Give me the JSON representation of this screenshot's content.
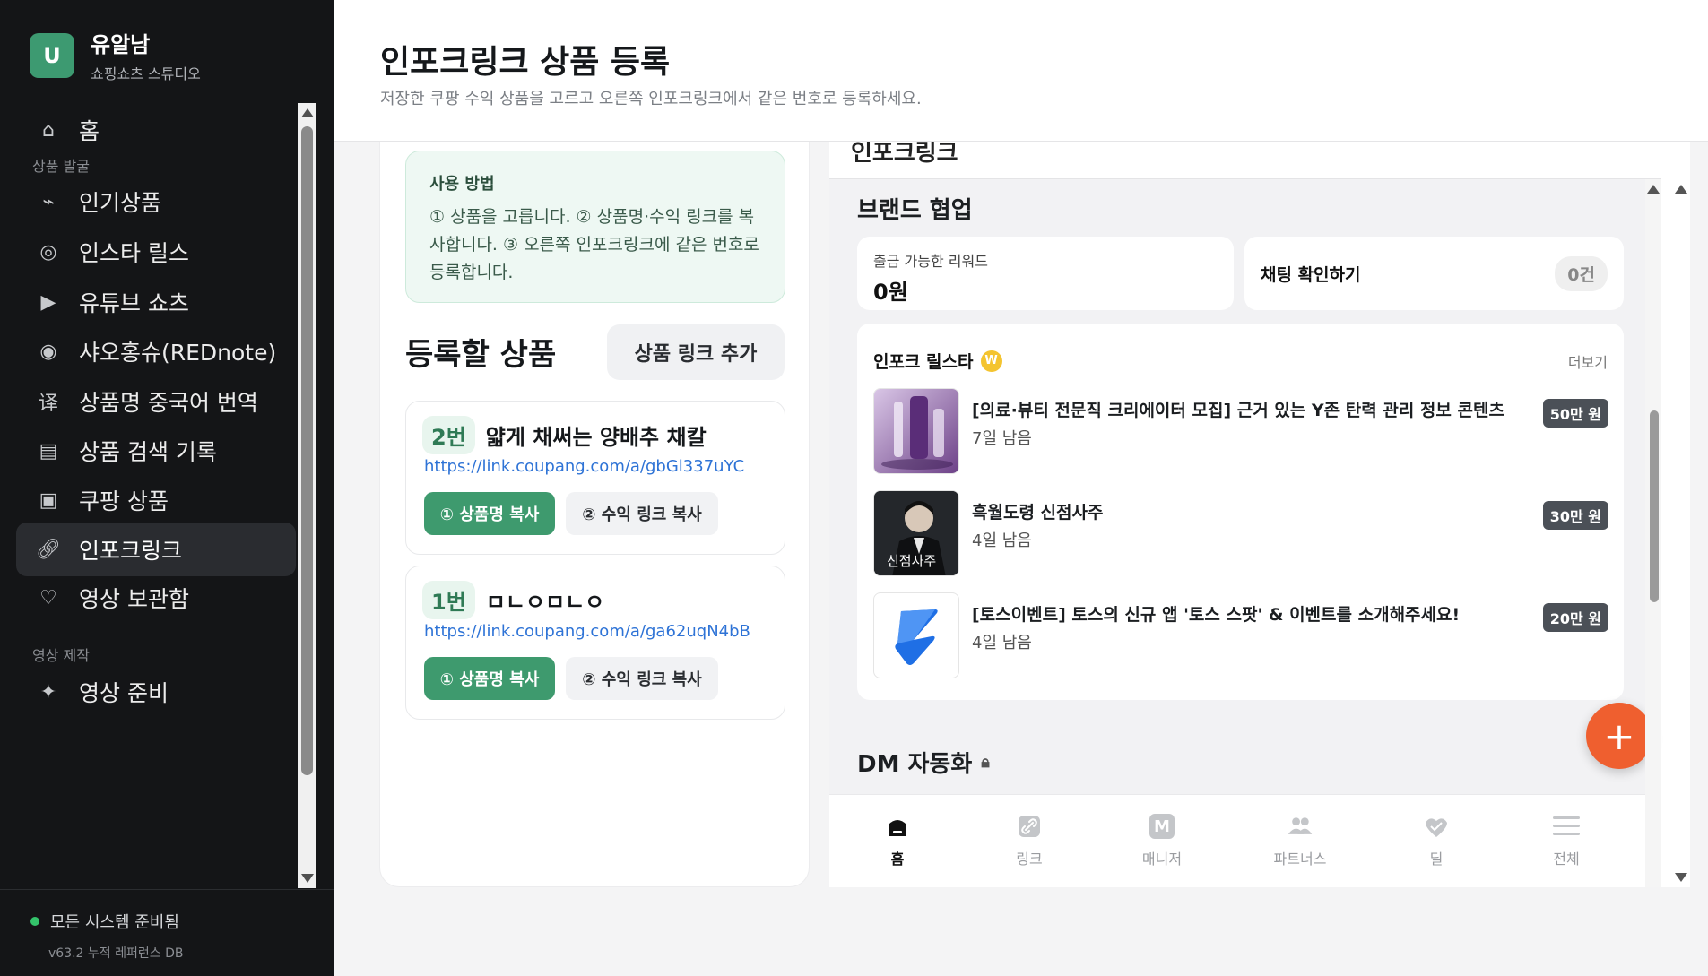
{
  "brand": {
    "initial": "U",
    "name": "유알남",
    "subtitle": "쇼핑쇼츠 스튜디오"
  },
  "sidebar": {
    "items": [
      {
        "label": "홈",
        "icon": "home-icon"
      },
      {
        "label": "인기상품",
        "icon": "trend-icon"
      },
      {
        "label": "인스타 릴스",
        "icon": "instagram-icon"
      },
      {
        "label": "유튜브 쇼츠",
        "icon": "play-icon"
      },
      {
        "label": "샤오홍슈(REDnote)",
        "icon": "record-icon"
      },
      {
        "label": "상품명 중국어 번역",
        "icon": "translate-icon"
      },
      {
        "label": "상품 검색 기록",
        "icon": "list-icon"
      },
      {
        "label": "쿠팡 상품",
        "icon": "box-icon"
      },
      {
        "label": "인포크링크",
        "icon": "link-icon"
      },
      {
        "label": "영상 보관함",
        "icon": "heart-icon"
      },
      {
        "label": "영상 준비",
        "icon": "sparkle-icon"
      }
    ],
    "sections": {
      "discover": "상품 발굴",
      "production": "영상 제작"
    },
    "active": "인포크링크",
    "status": "모든 시스템 준비됨",
    "version": "v63.2 누적 레퍼런스 DB"
  },
  "header": {
    "title": "인포크링크 상품 등록",
    "description": "저장한 쿠팡 수익 상품을 고르고 오른쪽 인포크링크에서 같은 번호로 등록하세요."
  },
  "howto": {
    "title": "사용 방법",
    "text": "① 상품을 고릅니다. ② 상품명·수익 링크를 복사합니다. ③ 오른쪽 인포크링크에 같은 번호로 등록합니다."
  },
  "register": {
    "title": "등록할 상품",
    "add_button": "상품 링크 추가",
    "products": [
      {
        "num": "2번",
        "name": "얇게 채써는 양배추 채칼",
        "link": "https://link.coupang.com/a/gbGl337uYC",
        "copy_name": "① 상품명 복사",
        "copy_link": "② 수익 링크 복사"
      },
      {
        "num": "1번",
        "name": "ㅁㄴㅇㅁㄴㅇ",
        "link": "https://link.coupang.com/a/ga62uqN4bB",
        "copy_name": "① 상품명 복사",
        "copy_link": "② 수익 링크 복사"
      }
    ]
  },
  "app": {
    "topbar_title": "인포크링크",
    "brand_collab": "브랜드 협업",
    "reward": {
      "label": "출금 가능한 리워드",
      "value": "0원"
    },
    "chat": {
      "label": "채팅 확인하기",
      "badge": "0건"
    },
    "list": {
      "title": "인포크 릴스타",
      "badge": "W",
      "more": "더보기",
      "campaigns": [
        {
          "title": "[의료·뷰티 전문직 크리에이터 모집] 근거 있는 Y존 탄력 관리 정보 콘텐츠",
          "days": "7일 남음",
          "amount": "50만 원"
        },
        {
          "title": "흑월도령 신점사주",
          "days": "4일 남음",
          "amount": "30만 원",
          "thumb_text": "신점사주"
        },
        {
          "title": "[토스이벤트] 토스의 신규 앱 '토스 스팟' & 이벤트를 소개해주세요!",
          "days": "4일 남음",
          "amount": "20만 원"
        }
      ]
    },
    "dm_title": "DM 자동화",
    "fab": "+",
    "tabs": [
      {
        "label": "홈",
        "icon": "home-tab-icon"
      },
      {
        "label": "링크",
        "icon": "link-tab-icon"
      },
      {
        "label": "매니저",
        "icon": "manager-tab-icon"
      },
      {
        "label": "파트너스",
        "icon": "partners-tab-icon"
      },
      {
        "label": "딜",
        "icon": "deal-tab-icon"
      },
      {
        "label": "전체",
        "icon": "menu-tab-icon"
      }
    ],
    "manager_letter": "M"
  },
  "colors": {
    "accent": "#3e9a6e",
    "sidebar_bg": "#141517",
    "fab": "#ef5f2f",
    "link": "#2e73d6"
  }
}
